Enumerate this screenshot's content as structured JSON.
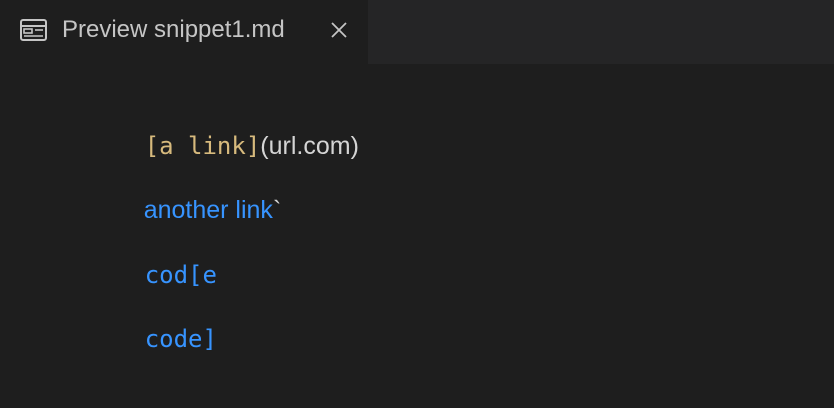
{
  "tab": {
    "title": "Preview snippet1.md",
    "icon": "preview-icon",
    "close_icon": "close-icon"
  },
  "preview": {
    "line1": {
      "code": "[a link]",
      "text": "(url.com)"
    },
    "line2": {
      "link": "another link",
      "text": "`"
    },
    "line3": {
      "code": "cod[e"
    },
    "line4": {
      "code": "code]"
    }
  },
  "colors": {
    "background": "#1e1e1e",
    "tabbar": "#252526",
    "tab_text": "#c5c5c5",
    "code_gold": "#d7ba7d",
    "text": "#d4d4d4",
    "link_blue": "#3794ff"
  }
}
